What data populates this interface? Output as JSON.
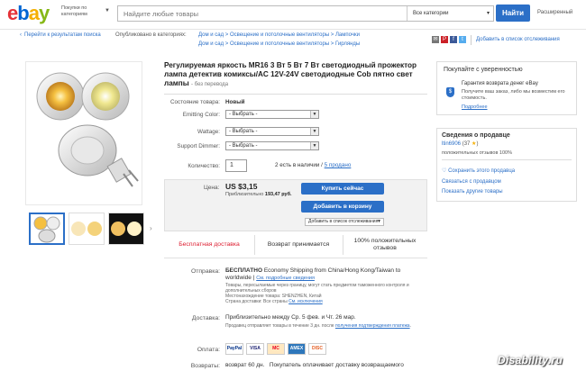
{
  "header": {
    "logo_letters": [
      "e",
      "b",
      "a",
      "y"
    ],
    "logo_colors": [
      "#e53238",
      "#0064d2",
      "#f5af02",
      "#86b817"
    ],
    "category_menu": "Покупки по категориям",
    "search_placeholder": "Найдите любые товары",
    "category_select": "Все категории",
    "find_button": "Найти",
    "advanced_link": "Расширенный"
  },
  "breadcrumb": {
    "back_link": "Перейти к результатам поиска",
    "published_in": "Опубликовано в категориях:",
    "path1": "Дом и сад > Освещение и потолочные вентиляторы > Лампочки",
    "path2": "Дом и сад > Освещение и потолочные вентиляторы > Гирлянды",
    "social_icons": [
      "mail-icon",
      "pinterest-icon",
      "facebook-icon",
      "twitter-icon"
    ],
    "watch_link": "Добавить в список отслеживания"
  },
  "listing": {
    "title": "Регулируемая яркость MR16 3 Вт 5 Вт 7 Вт светодиодный прожектор лампа детектив комиксы/AC 12V-24V светодиодные Cob пятно свет лампы",
    "title_suffix": "- без перевода",
    "condition_label": "Состояние товара:",
    "condition_value": "Новый",
    "emitting_color_label": "Emitting Color:",
    "emitting_color_value": "- Выбрать -",
    "wattage_label": "Wattage:",
    "wattage_value": "- Выбрать -",
    "dimmer_label": "Support Dimmer:",
    "dimmer_value": "- Выбрать -",
    "quantity_label": "Количество:",
    "quantity_value": "1",
    "available_text": "2 есть в наличии /",
    "sold_link": "5 продано"
  },
  "buybox": {
    "price_label": "Цена:",
    "price": "US $3,15",
    "approx_label": "Приблизительно",
    "approx_value": "193,47 руб.",
    "buy_now": "Купить сейчас",
    "add_to_cart": "Добавить в корзину",
    "add_to_watch": "Добавить в список отслеживания",
    "free_shipping": "Бесплатная доставка",
    "returns": "Возврат принимается",
    "positive_feedback": "100% положительных отзывов"
  },
  "shipping": {
    "shipping_label": "Отправка:",
    "shipping_free": "БЕСПЛАТНО",
    "shipping_method": "Economy Shipping from China/Hong Kong/Taiwan to worldwide",
    "shipping_sep": "|",
    "details_link": "См. подробные сведения",
    "shipping_note": "Товары, пересылаемые через границу, могут стать предметом таможенного контроля и дополнительных сборов",
    "location": "Местонахождение товара: SHENZHEN, Китай",
    "ship_to": "Страна доставки: Все страны",
    "exclusions_link": "См. исключения",
    "delivery_label": "Доставка:",
    "delivery_text": "Приблизительно между Ср. 5 фев. и Чт. 26 мар.",
    "delivery_note": "Продавец отправляет товары в течение 3 дн. после",
    "payment_receipt_link": "получения подтверждения платежа",
    "delivery_note_end": ".",
    "payment_label": "Оплата:",
    "payment_methods": [
      "PayPal",
      "VISA",
      "MC",
      "AMEX",
      "DISC"
    ],
    "returns_label": "Возвраты:",
    "returns_text": "возврат 60 дн.   Покупатель оплачивает доставку возвращаемого"
  },
  "guarantee": {
    "title": "Покупайте с уверенностью",
    "heading": "Гарантия возврата денег eBay",
    "text": "Получите ваш заказ, либо мы возместим его стоимость.",
    "more_link": "Подробнее"
  },
  "seller": {
    "title": "Сведения о продавце",
    "name": "ltin6906",
    "feedback_count": "(37",
    "feedback_star": "★",
    "feedback_close": ")",
    "positive": "положительных отзывов 100%",
    "save_seller": "Сохранить этого продавца",
    "contact": "Связаться с продавцом",
    "other_items": "Показать другие товары"
  },
  "watermark": "Disability.ru"
}
